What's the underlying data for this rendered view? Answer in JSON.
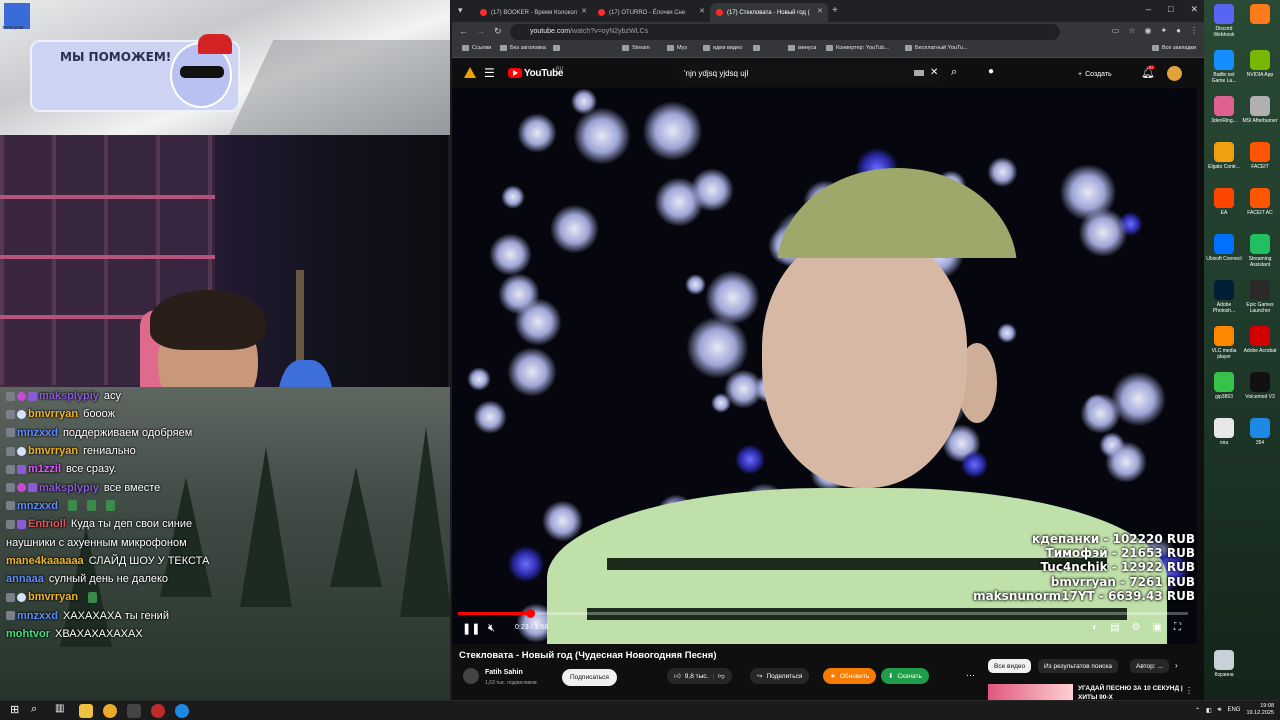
{
  "overlay": {
    "tray_label": "телеграм",
    "banner_title": "МЫ ПОМОЖЕМ!"
  },
  "chat": {
    "messages": [
      {
        "user": "maksplypiy",
        "text": "асу",
        "color": "#8c5bd8",
        "badges": [
          "sub",
          "heart",
          "star"
        ],
        "emotes": 0
      },
      {
        "user": "bmvrryan",
        "text": "бооож",
        "color": "#f0b429",
        "badges": [
          "sub",
          "check"
        ],
        "emotes": 0
      },
      {
        "user": "mnzxxd",
        "text": "поддерживаем одобряем",
        "color": "#5e8cff",
        "badges": [
          "sub"
        ],
        "emotes": 0
      },
      {
        "user": "bmvrryan",
        "text": "гениально",
        "color": "#f0b429",
        "badges": [
          "sub",
          "check"
        ],
        "emotes": 0
      },
      {
        "user": "m1zzil",
        "text": "все сразу.",
        "color": "#d958ff",
        "badges": [
          "sub",
          "star"
        ],
        "emotes": 0
      },
      {
        "user": "maksplypiy",
        "text": "все вместе",
        "color": "#8c5bd8",
        "badges": [
          "sub",
          "heart",
          "star"
        ],
        "emotes": 0
      },
      {
        "user": "mnzxxd",
        "text": "",
        "color": "#5e8cff",
        "badges": [
          "sub"
        ],
        "emotes": 3
      },
      {
        "user": "Entrioll",
        "text": "Куда ты деп свои синие",
        "color": "#e05555",
        "badges": [
          "sub",
          "star"
        ],
        "emotes": 0
      },
      {
        "user": "",
        "text": "наушники с ахуенным микрофоном",
        "color": "#ffffff",
        "badges": [],
        "emotes": 0
      },
      {
        "user": "mane4kaaaaaa",
        "text": "СЛАЙД ШОУ У ТЕКСТА",
        "color": "#f0b429",
        "badges": [],
        "emotes": 0
      },
      {
        "user": "annaaa",
        "text": "сулный день не далеко",
        "color": "#5e8cff",
        "badges": [],
        "emotes": 0
      },
      {
        "user": "bmvrryan",
        "text": "",
        "color": "#f0b429",
        "badges": [
          "sub",
          "check"
        ],
        "emotes": 1
      },
      {
        "user": "mnzxxd",
        "text": "ХАХАХАХА ты гений",
        "color": "#5e8cff",
        "badges": [
          "sub"
        ],
        "emotes": 0
      },
      {
        "user": "mohtvor",
        "text": "ХВАХАХАХАХАХ",
        "color": "#3fe07a",
        "badges": [],
        "emotes": 0
      }
    ]
  },
  "browser": {
    "tabs": [
      {
        "label": "(17) BOOKER - Время Колокол"
      },
      {
        "label": "(17) OTURRO - Ёлочки Сне"
      },
      {
        "label": "(17) Стекловата - Новый год (",
        "active": true
      }
    ],
    "url_main": "youtube.com",
    "url_rest": "/watch?v=oyN2ybzWLCs",
    "bookmarks": [
      "Ссылки",
      "Без заголовка",
      "",
      "Stream",
      "Муз",
      "идеи видео",
      "",
      "минуса",
      "Конвертер: YouTub...",
      "Бесплатный YouTu...",
      "Все закладки"
    ]
  },
  "youtube": {
    "logo": "YouTube",
    "logo_sup": "RU",
    "search_value": "'njn ydjsq yjdsq ujl",
    "create_label": "Создать",
    "bell_badge": "9+",
    "time_display": "0:23 / 3:58",
    "progress_fraction": 0.098,
    "video_title": "Стекловата - Новый год (Чудесная Новогодняя Песня)",
    "channel_name": "Fatih Sahin",
    "channel_subs": "1,63 тыс. подписчиков",
    "subscribe_label": "Подписаться",
    "likes": "9,8 тыс.",
    "share_label": "Поделиться",
    "upgrade_label": "Обновить",
    "download_label": "Скачать",
    "chips": [
      "Все видео",
      "Из результатов поиска",
      "Автор: ..."
    ],
    "rec_title": "УГАДАЙ ПЕСНЮ ЗА 10 СЕКУНД | ХИТЫ 90-Х"
  },
  "donations": [
    "кдепанки - 102220 RUB",
    "Тимофэй - 21653 RUB",
    "Tuc4nchik - 12922 RUB",
    "bmvrryan - 7261 RUB",
    "maksnunorm17YT - 6639.43 RUB"
  ],
  "desktop_icons": [
    {
      "label": "Discord Webhook",
      "color": "#5865f2"
    },
    {
      "label": "",
      "color": "#ff7a1a"
    },
    {
      "label": "Battle.net Game La...",
      "color": "#148eff"
    },
    {
      "label": "NVIDIA App",
      "color": "#76b900"
    },
    {
      "label": "3denRing...",
      "color": "#e06090"
    },
    {
      "label": "MSI Afterburner",
      "color": "#b0b0b0"
    },
    {
      "label": "Elgato Contr...",
      "color": "#f0a010"
    },
    {
      "label": "FACEIT",
      "color": "#ff5500"
    },
    {
      "label": "EA",
      "color": "#ff4500"
    },
    {
      "label": "FACEIT AC",
      "color": "#ff5500"
    },
    {
      "label": "Ubisoft Connect",
      "color": "#0070ff"
    },
    {
      "label": "Streaming Assistant",
      "color": "#20c060"
    },
    {
      "label": "Adobe Photosh...",
      "color": "#001e36"
    },
    {
      "label": "Epic Games Launcher",
      "color": "#2a2a2a"
    },
    {
      "label": "VLC media player",
      "color": "#ff8800"
    },
    {
      "label": "Adobe Acrobat",
      "color": "#d40000"
    },
    {
      "label": "gip3863",
      "color": "#37c34a"
    },
    {
      "label": "Voicemod V3",
      "color": "#111111"
    },
    {
      "label": "опа",
      "color": "#e8e8e8"
    },
    {
      "label": "354",
      "color": "#1e88e5"
    },
    {
      "label": "Корзина",
      "color": "#c8d0d8"
    }
  ],
  "taskbar": {
    "lang": "ENG",
    "time": "19:08",
    "date": "19.12.2025"
  }
}
